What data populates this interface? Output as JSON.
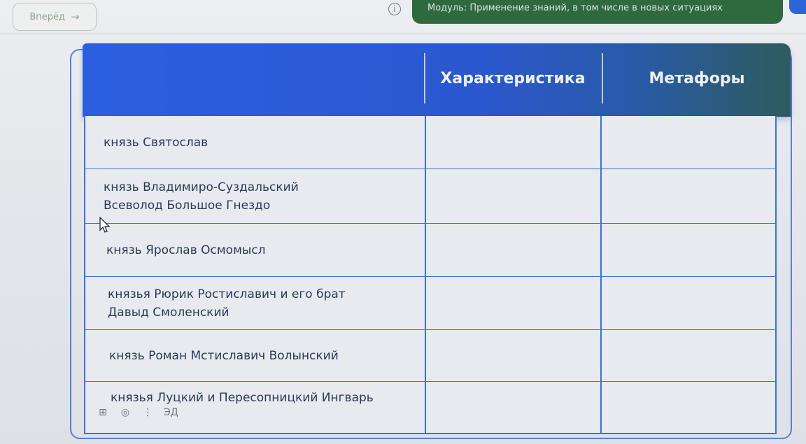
{
  "topbar": {
    "forward_label": "Вперёд",
    "forward_arrow": "→",
    "info_icon": "i",
    "module_text": "Модуль: Применение знаний, в том числе в новых ситуациях"
  },
  "table": {
    "headers": [
      "",
      "Характеристика",
      "Метафоры"
    ],
    "rows": [
      {
        "name": "князь Святослав"
      },
      {
        "name": "князь Владимиро-Суздальский Всеволод Большое Гнездо"
      },
      {
        "name": "князь Ярослав Осмомысл"
      },
      {
        "name": "князья Рюрик Ростиславич и его брат Давыд Смоленский"
      },
      {
        "name": "князь Роман Мстиславич Волынский"
      },
      {
        "name": "князья Луцкий и Пересопницкий Ингварь"
      }
    ]
  },
  "tools": {
    "t1": "⊞",
    "t2": "◎",
    "t3": "⋮",
    "t4": "ЭД"
  },
  "colors": {
    "header_blue": "#2c5fe0",
    "module_green": "#2f6a3f",
    "grid_line": "#3d6ee6"
  }
}
